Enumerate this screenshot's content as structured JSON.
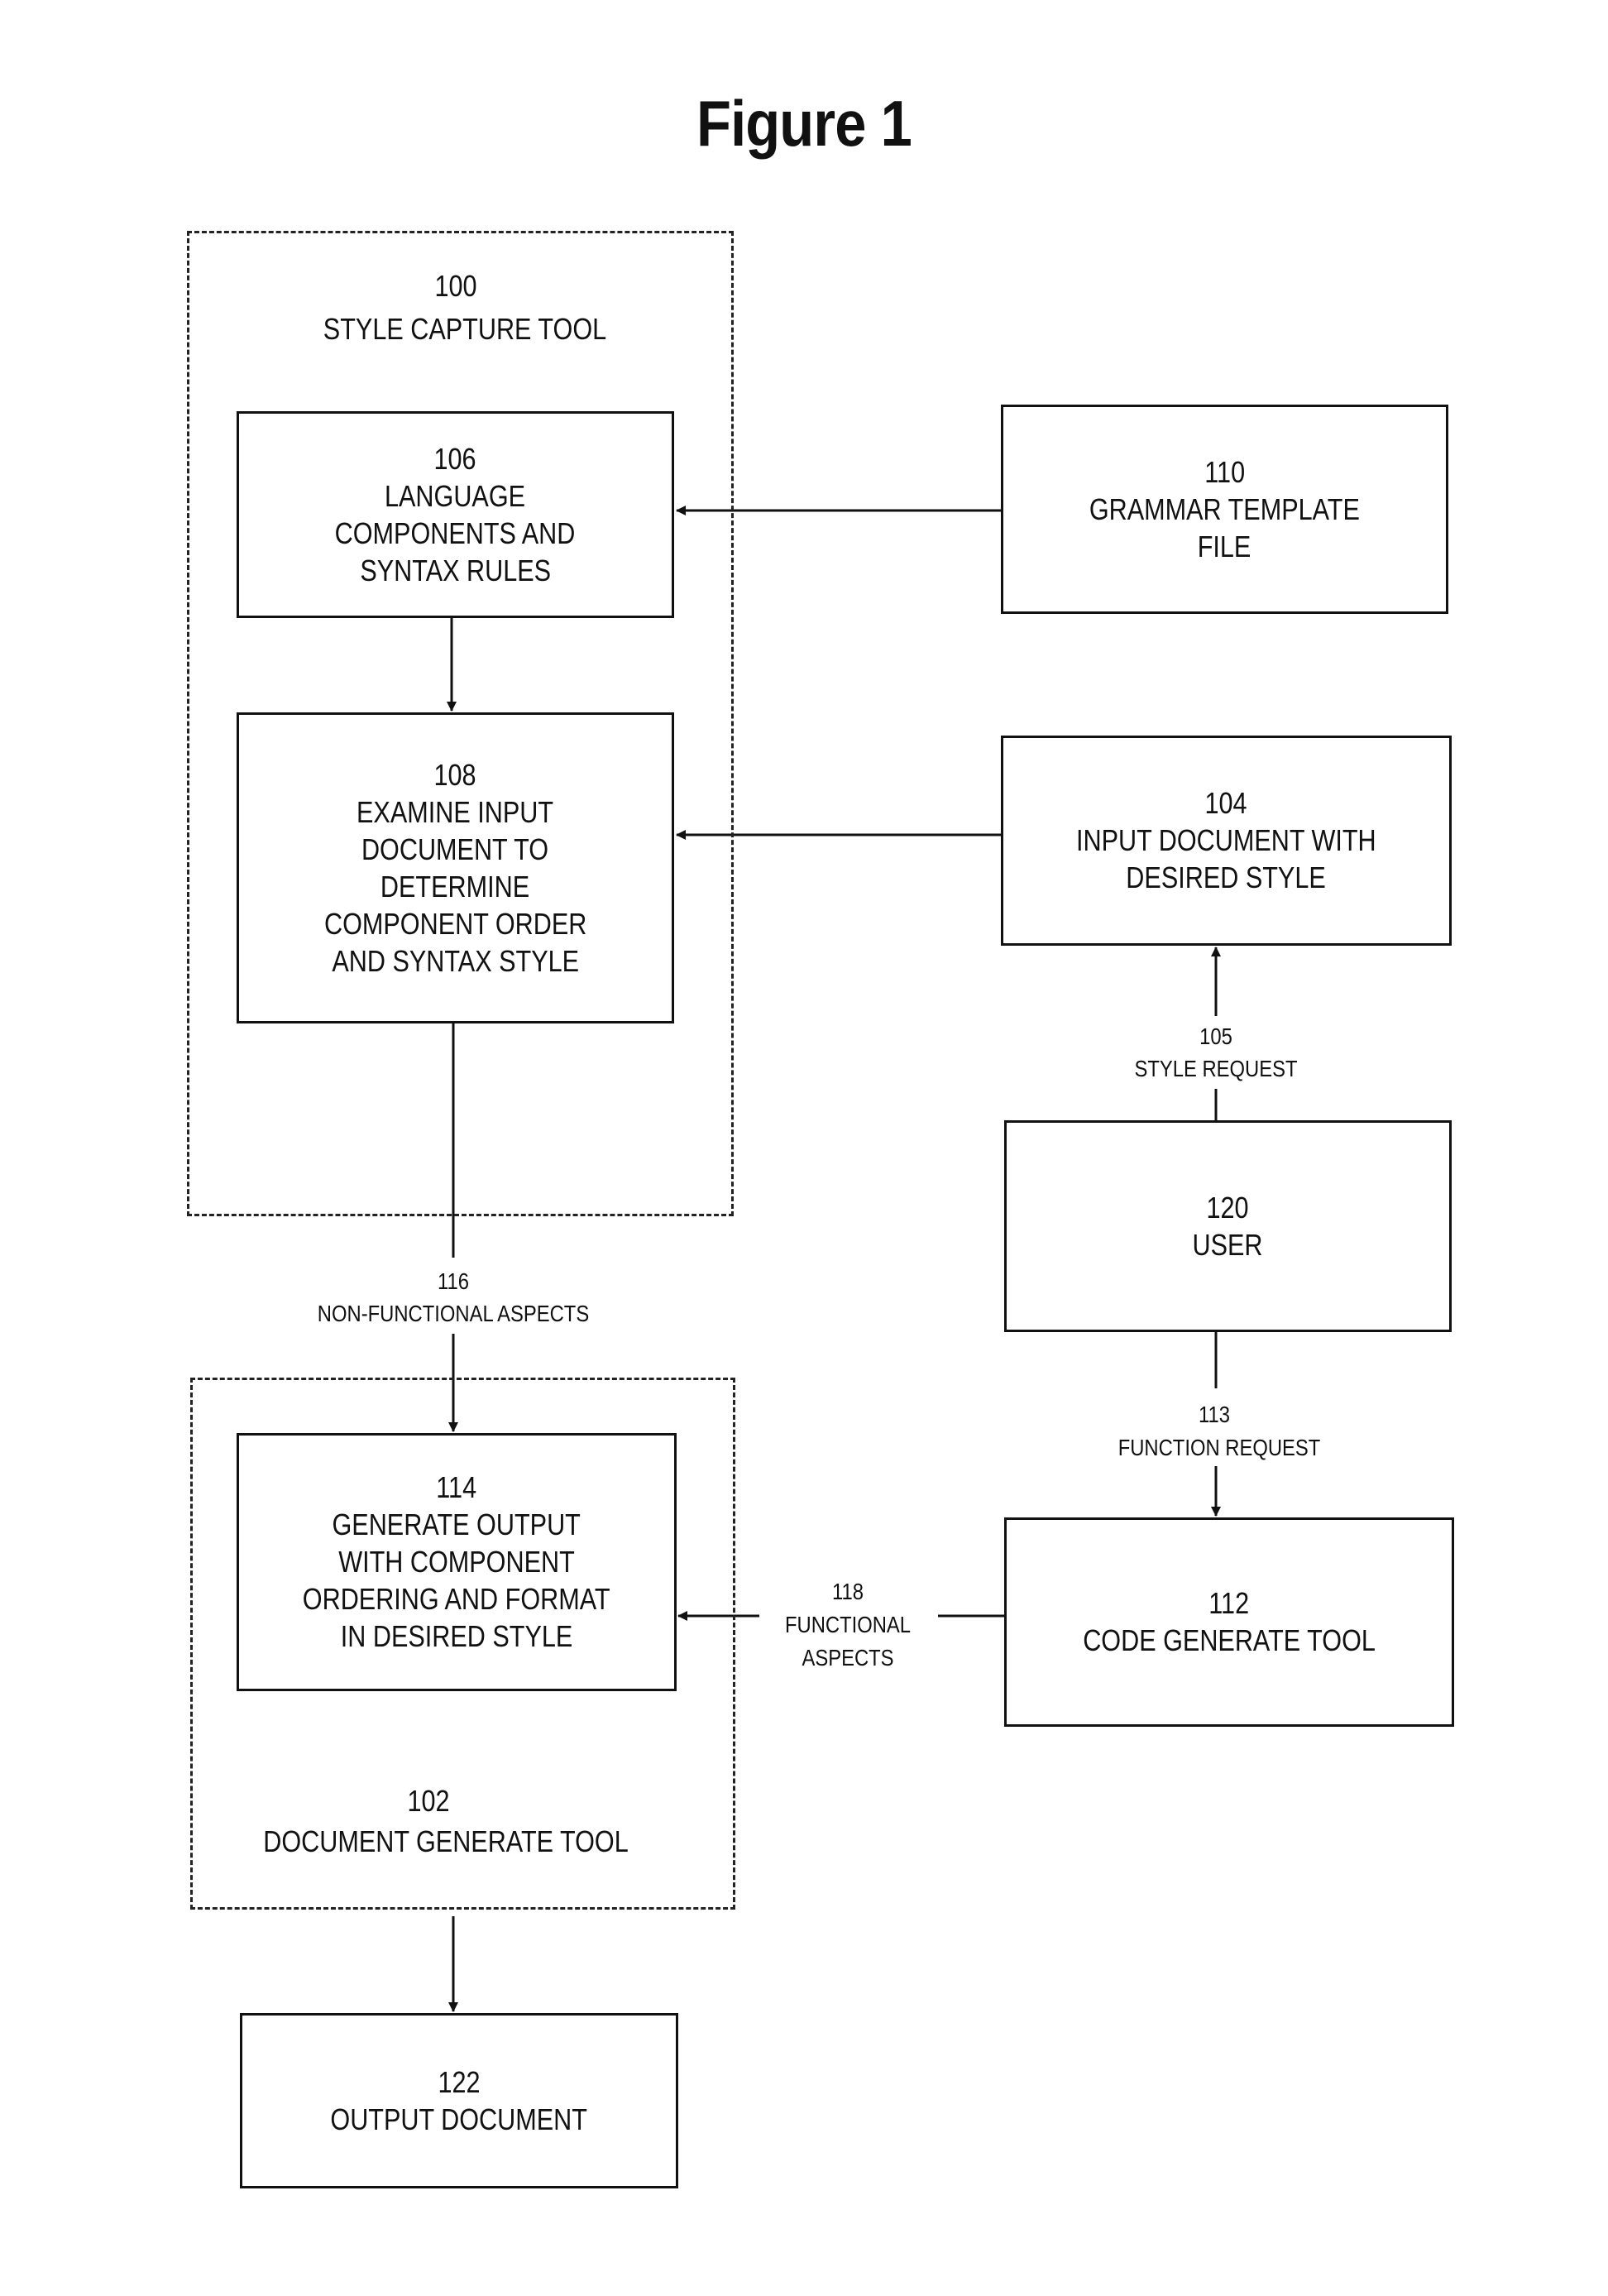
{
  "figure": {
    "title": "Figure 1"
  },
  "groups": {
    "style_capture_tool": {
      "number": "100",
      "label": "STYLE CAPTURE TOOL"
    },
    "document_generate_tool": {
      "number": "102",
      "label": "DOCUMENT GENERATE TOOL"
    }
  },
  "boxes": {
    "b106": {
      "number": "106",
      "lines": [
        "LANGUAGE",
        "COMPONENTS AND",
        "SYNTAX RULES"
      ]
    },
    "b110": {
      "number": "110",
      "lines": [
        "GRAMMAR TEMPLATE",
        "FILE"
      ]
    },
    "b108": {
      "number": "108",
      "lines": [
        "EXAMINE INPUT",
        "DOCUMENT TO",
        "DETERMINE",
        "COMPONENT ORDER",
        "AND SYNTAX STYLE"
      ]
    },
    "b104": {
      "number": "104",
      "lines": [
        "INPUT DOCUMENT WITH",
        "DESIRED STYLE"
      ]
    },
    "b120": {
      "number": "120",
      "lines": [
        "USER"
      ]
    },
    "b114": {
      "number": "114",
      "lines": [
        "GENERATE OUTPUT",
        "WITH COMPONENT",
        "ORDERING AND FORMAT",
        "IN DESIRED STYLE"
      ]
    },
    "b112": {
      "number": "112",
      "lines": [
        "CODE GENERATE TOOL"
      ]
    },
    "b122": {
      "number": "122",
      "lines": [
        "OUTPUT DOCUMENT"
      ]
    }
  },
  "connectors": {
    "c105": {
      "number": "105",
      "lines": [
        "STYLE REQUEST"
      ]
    },
    "c116": {
      "number": "116",
      "lines": [
        "NON-FUNCTIONAL ASPECTS"
      ]
    },
    "c113": {
      "number": "113",
      "lines": [
        "FUNCTION REQUEST"
      ]
    },
    "c118": {
      "number": "118",
      "lines": [
        "FUNCTIONAL",
        "ASPECTS"
      ]
    }
  }
}
